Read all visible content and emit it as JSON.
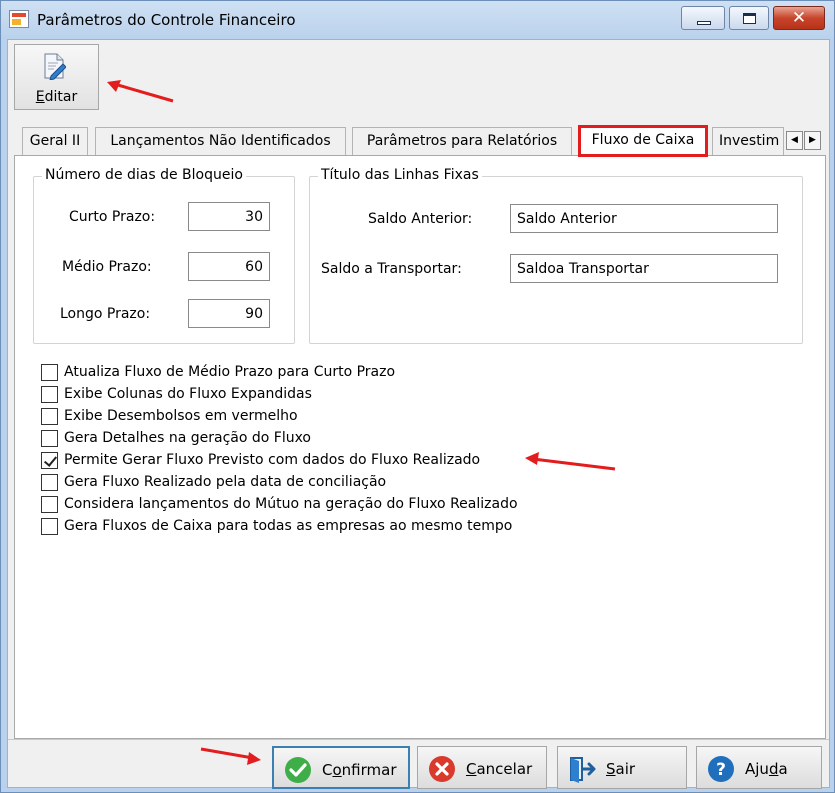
{
  "window": {
    "title": "Parâmetros do Controle Financeiro",
    "controls": [
      "minimize",
      "maximize",
      "close"
    ],
    "close_glyph": "✕"
  },
  "toolbar": {
    "edit_label": "Editar",
    "edit_label_underline": "E",
    "edit_label_rest": "ditar",
    "edit_icon": "edit-document-icon"
  },
  "tabs": [
    {
      "label": "Geral II",
      "active": false
    },
    {
      "label": "Lançamentos Não Identificados",
      "active": false
    },
    {
      "label": "Parâmetros para Relatórios",
      "active": false
    },
    {
      "label": "Fluxo de Caixa",
      "active": true
    },
    {
      "label": "Investim",
      "active": false
    }
  ],
  "tab_scroll": {
    "left": "◀",
    "right": "▶"
  },
  "bloqueio": {
    "title": "Número de dias de Bloqueio",
    "curto_label": "Curto Prazo:",
    "curto_value": "30",
    "medio_label": "Médio Prazo:",
    "medio_value": "60",
    "longo_label": "Longo Prazo:",
    "longo_value": "90"
  },
  "linhas_fixas": {
    "title": "Título das Linhas Fixas",
    "saldo_anterior_label": "Saldo Anterior:",
    "saldo_anterior_value": "Saldo Anterior",
    "saldo_transportar_label": "Saldo a Transportar:",
    "saldo_transportar_value": "Saldoa Transportar"
  },
  "options": [
    {
      "label": "Atualiza Fluxo de Médio Prazo para Curto Prazo",
      "checked": false
    },
    {
      "label": "Exibe Colunas do Fluxo Expandidas",
      "checked": false
    },
    {
      "label": "Exibe Desembolsos  em vermelho",
      "checked": false
    },
    {
      "label": "Gera Detalhes na geração do Fluxo",
      "checked": false
    },
    {
      "label": "Permite Gerar Fluxo Previsto com dados do Fluxo Realizado",
      "checked": true
    },
    {
      "label": "Gera Fluxo Realizado pela data de conciliação",
      "checked": false
    },
    {
      "label": "Considera lançamentos do Mútuo na geração do Fluxo Realizado",
      "checked": false
    },
    {
      "label": "Gera Fluxos de Caixa para todas as empresas ao mesmo tempo",
      "checked": false
    }
  ],
  "buttons": {
    "confirmar": {
      "label": "Confirmar",
      "underline": "o",
      "pre": "C",
      "post": "nfirmar",
      "icon": "check-circle-icon"
    },
    "cancelar": {
      "label": "Cancelar",
      "underline": "C",
      "pre": "",
      "post": "ancelar",
      "icon": "x-circle-icon"
    },
    "sair": {
      "label": "Sair",
      "underline": "S",
      "pre": "",
      "post": "air",
      "icon": "exit-door-icon"
    },
    "ajuda": {
      "label": "Ajuda",
      "underline": "d",
      "pre": "Aju",
      "post": "a",
      "icon": "help-icon"
    }
  },
  "colors": {
    "highlight_red": "#e31d1d",
    "confirm_green": "#3fae49",
    "cancel_red": "#d93a2b",
    "help_blue": "#1f6fbd"
  }
}
